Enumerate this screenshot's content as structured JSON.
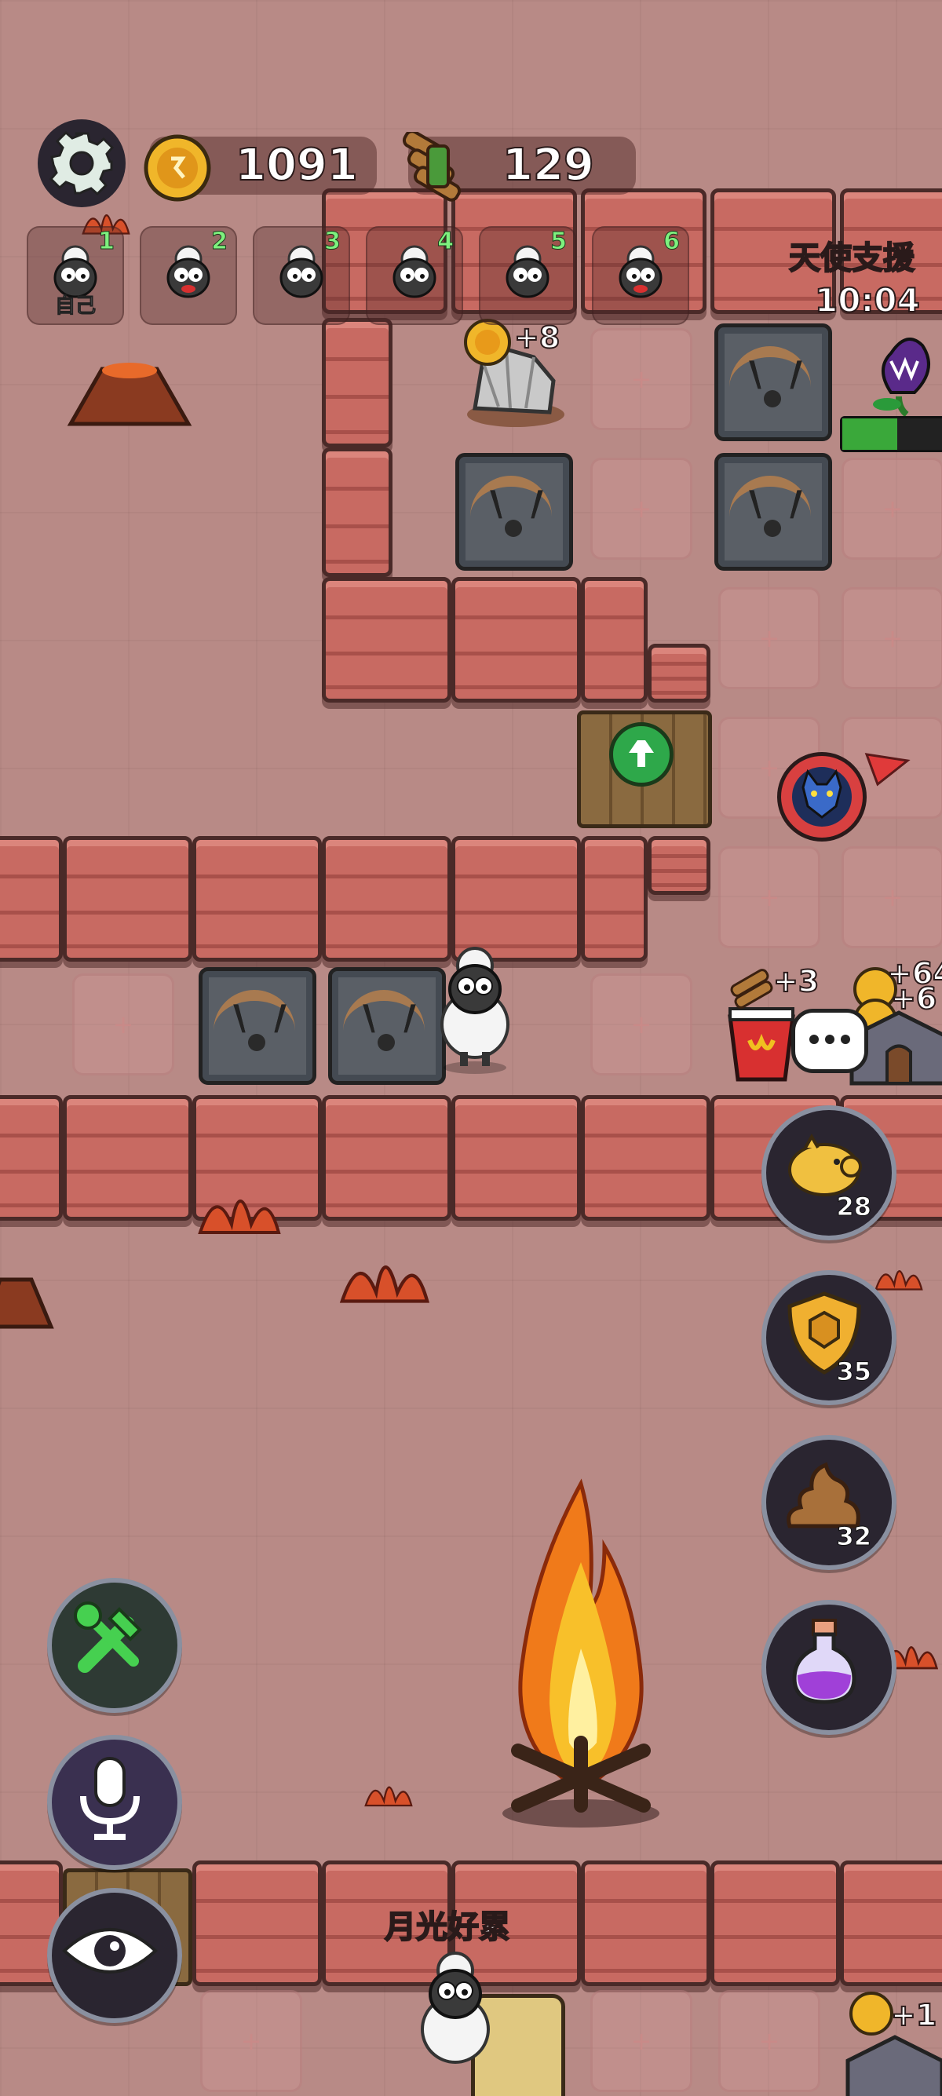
{
  "resources": {
    "gold": "1091",
    "wood": "129"
  },
  "players": [
    {
      "num": "1",
      "label": "自己"
    },
    {
      "num": "2",
      "label": ""
    },
    {
      "num": "3",
      "label": ""
    },
    {
      "num": "4",
      "label": ""
    },
    {
      "num": "5",
      "label": ""
    },
    {
      "num": "6",
      "label": ""
    }
  ],
  "event": {
    "title": "天使支援",
    "timer": "10:04"
  },
  "map": {
    "rock_bonus": "+8",
    "shop_bonus": "+3",
    "house_bonus_1": "+64",
    "house_bonus_2": "+6",
    "house_bonus_3": "+1",
    "floor_marker": "+"
  },
  "skills": [
    {
      "name": "piggy-bank",
      "count": "28"
    },
    {
      "name": "shield",
      "count": "35"
    },
    {
      "name": "poop",
      "count": "32"
    },
    {
      "name": "potion",
      "count": ""
    }
  ],
  "other_player": {
    "name": "月光好累"
  },
  "colors": {
    "wall": "#c86a62",
    "floor": "#b88a86",
    "count_green": "#7ef07e",
    "health_bar": "#3aa83a"
  }
}
